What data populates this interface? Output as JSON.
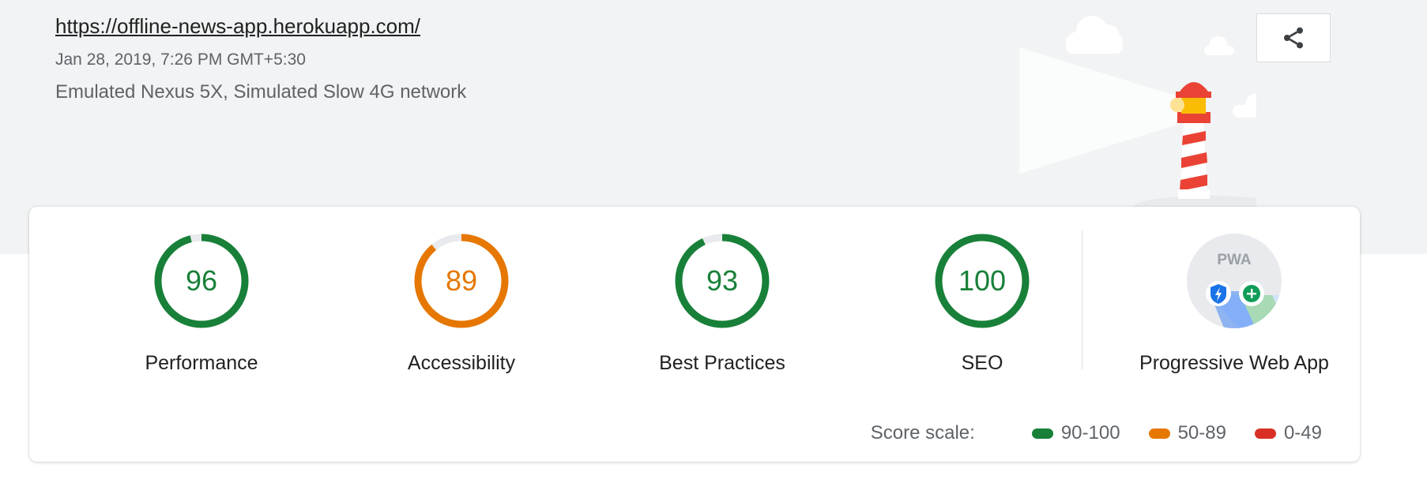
{
  "header": {
    "url": "https://offline-news-app.herokuapp.com/",
    "date": "Jan 28, 2019, 7:26 PM GMT+5:30",
    "environment": "Emulated Nexus 5X, Simulated Slow 4G network"
  },
  "share_button": {
    "icon": "share-icon"
  },
  "gauges": [
    {
      "name": "performance",
      "score": "96",
      "label": "Performance",
      "fraction": 0.96,
      "color": "#188038"
    },
    {
      "name": "accessibility",
      "score": "89",
      "label": "Accessibility",
      "fraction": 0.89,
      "color": "#e67700"
    },
    {
      "name": "best-practices",
      "score": "93",
      "label": "Best Practices",
      "fraction": 0.93,
      "color": "#188038"
    },
    {
      "name": "seo",
      "score": "100",
      "label": "SEO",
      "fraction": 1.0,
      "color": "#188038"
    }
  ],
  "pwa": {
    "badge_text": "PWA",
    "label": "Progressive Web App",
    "icons": [
      "shield-lightning-icon",
      "plus-icon"
    ]
  },
  "legend": {
    "title": "Score scale:",
    "items": [
      {
        "range": "90-100",
        "color": "#188038"
      },
      {
        "range": "50-89",
        "color": "#e67700"
      },
      {
        "range": "0-49",
        "color": "#d93025"
      }
    ]
  },
  "colors": {
    "pass": "#188038",
    "average": "#e67700",
    "fail": "#d93025",
    "track": "#e8eaed"
  }
}
